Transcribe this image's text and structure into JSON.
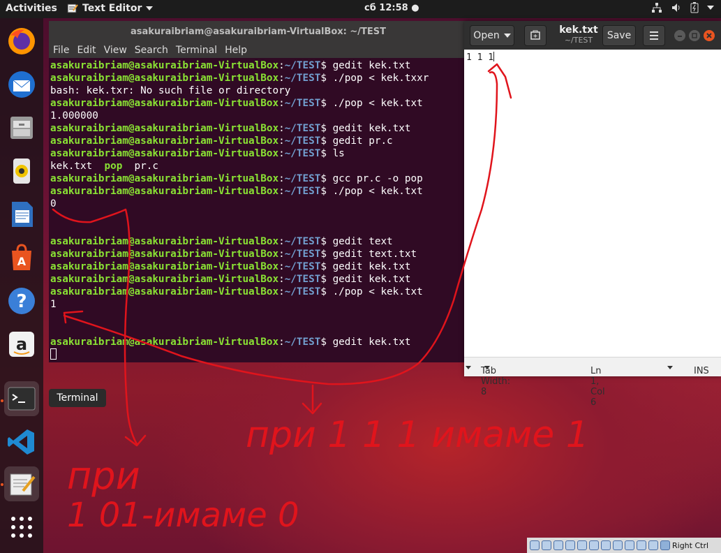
{
  "topbar": {
    "activities": "Activities",
    "app_menu": "Text Editor",
    "clock": "сб 12:58"
  },
  "dock": {
    "tooltip": "Terminal",
    "items": [
      "Firefox",
      "Thunderbird",
      "Files",
      "Rhythmbox",
      "LibreOffice Writer",
      "Ubuntu Software",
      "Help",
      "Amazon",
      "Terminal",
      "Visual Studio Code",
      "Text Editor",
      "Show Applications"
    ]
  },
  "terminal": {
    "title": "asakuraibriam@asakuraibriam-VirtualBox: ~/TEST",
    "menu": [
      "File",
      "Edit",
      "View",
      "Search",
      "Terminal",
      "Help"
    ],
    "user": "asakuraibriam@asakuraibriam-VirtualBox",
    "path": "~/TEST",
    "lines": [
      {
        "type": "prompt",
        "cmd": "gedit kek.txt"
      },
      {
        "type": "prompt",
        "cmd": "./pop < kek.txxr"
      },
      {
        "type": "out",
        "text": "bash: kek.txr: No such file or directory"
      },
      {
        "type": "prompt",
        "cmd": "./pop < kek.txt"
      },
      {
        "type": "out",
        "text": "1.000000"
      },
      {
        "type": "prompt",
        "cmd": "gedit kek.txt"
      },
      {
        "type": "prompt",
        "cmd": "gedit pr.c"
      },
      {
        "type": "prompt",
        "cmd": "ls"
      },
      {
        "type": "ls",
        "items": [
          "kek.txt",
          "pop",
          "pr.c"
        ]
      },
      {
        "type": "prompt",
        "cmd": "gcc pr.c -o pop"
      },
      {
        "type": "prompt",
        "cmd": "./pop < kek.txt"
      },
      {
        "type": "out",
        "text": "0"
      },
      {
        "type": "out",
        "text": ""
      },
      {
        "type": "out",
        "text": ""
      },
      {
        "type": "prompt",
        "cmd": "gedit text"
      },
      {
        "type": "prompt",
        "cmd": "gedit text.txt"
      },
      {
        "type": "prompt",
        "cmd": "gedit kek.txt"
      },
      {
        "type": "prompt",
        "cmd": "gedit kek.txt"
      },
      {
        "type": "prompt",
        "cmd": "./pop < kek.txt"
      },
      {
        "type": "out",
        "text": "1"
      },
      {
        "type": "out",
        "text": ""
      },
      {
        "type": "out",
        "text": ""
      },
      {
        "type": "prompt",
        "cmd": "gedit kek.txt"
      },
      {
        "type": "cursor"
      }
    ]
  },
  "gedit": {
    "open_label": "Open",
    "save_label": "Save",
    "file_name": "kek.txt",
    "file_path": "~/TEST",
    "content": "1 1 1",
    "tab_width": "Tab Width: 8",
    "position": "Ln 1, Col 6",
    "mode": "INS"
  },
  "vbox": {
    "host_key": "Right Ctrl"
  },
  "annotations": {
    "left_text_1": "при",
    "left_text_2": "1 01-имаме 0",
    "right_text": "при 1 1 1 имаме 1",
    "color": "#e0141c"
  }
}
